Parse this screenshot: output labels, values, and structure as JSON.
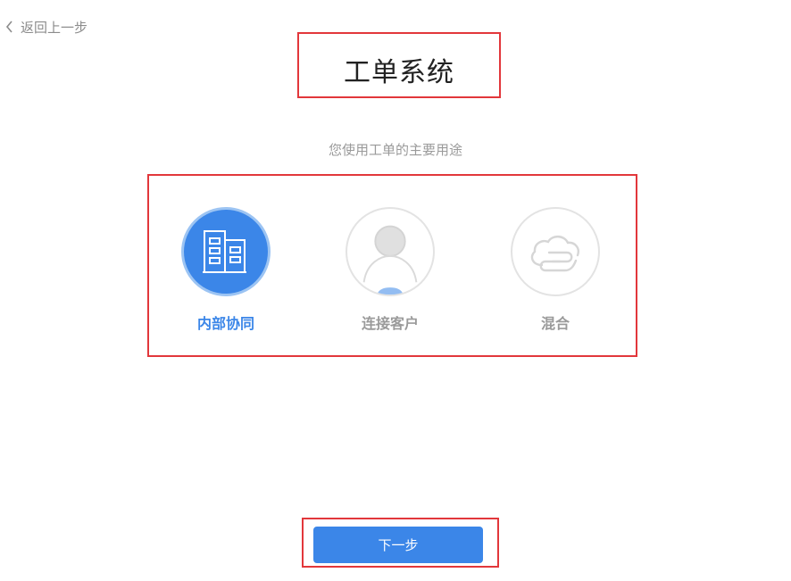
{
  "nav": {
    "back_label": "返回上一步",
    "back_icon": "chevron-left-icon"
  },
  "page": {
    "title": "工单系统",
    "subtitle": "您使用工单的主要用途"
  },
  "options": [
    {
      "label": "内部协同",
      "icon": "building-icon",
      "selected": true
    },
    {
      "label": "连接客户",
      "icon": "user-icon",
      "selected": false
    },
    {
      "label": "混合",
      "icon": "cloud-icon",
      "selected": false
    }
  ],
  "actions": {
    "next_label": "下一步"
  },
  "colors": {
    "accent": "#3b86e8",
    "accent_light": "#9cc4f3",
    "inactive_text": "#9a9a9a",
    "inactive_border": "#e3e3e3",
    "annotation": "#e2373b"
  }
}
